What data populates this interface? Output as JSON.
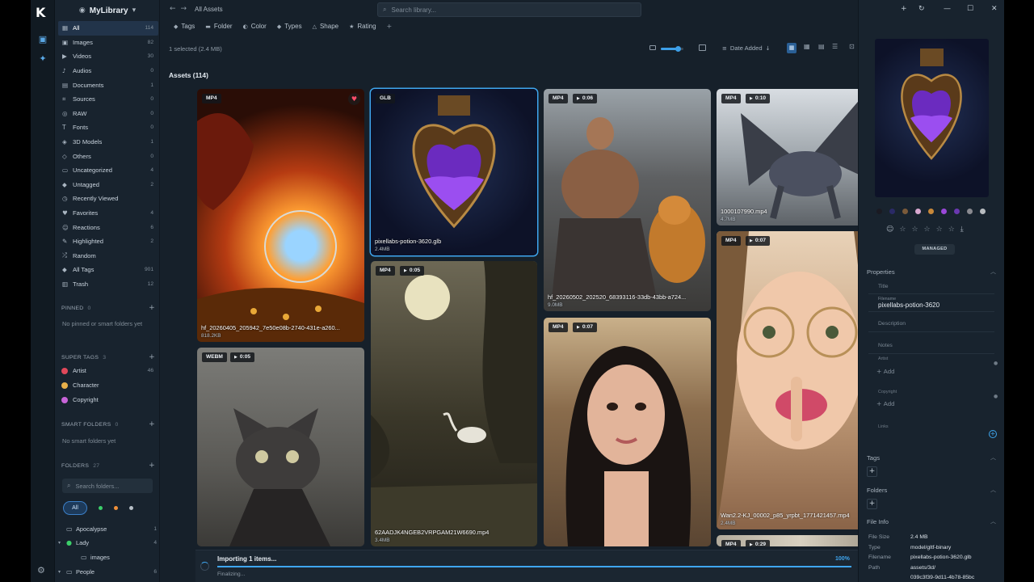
{
  "app": {
    "logo": "K",
    "library_name": "MyLibrary"
  },
  "sidebar": {
    "items": [
      {
        "icon": "grid-icon",
        "glyph": "▦",
        "label": "All",
        "count": "114",
        "active": true
      },
      {
        "icon": "image-icon",
        "glyph": "▣",
        "label": "Images",
        "count": "82"
      },
      {
        "icon": "video-icon",
        "glyph": "▶",
        "label": "Videos",
        "count": "30"
      },
      {
        "icon": "audio-icon",
        "glyph": "♪",
        "label": "Audios",
        "count": "0"
      },
      {
        "icon": "document-icon",
        "glyph": "▤",
        "label": "Documents",
        "count": "1"
      },
      {
        "icon": "source-icon",
        "glyph": "⌗",
        "label": "Sources",
        "count": "0"
      },
      {
        "icon": "raw-icon",
        "glyph": "◎",
        "label": "RAW",
        "count": "0"
      },
      {
        "icon": "font-icon",
        "glyph": "T",
        "label": "Fonts",
        "count": "0"
      },
      {
        "icon": "cube-icon",
        "glyph": "◈",
        "label": "3D Models",
        "count": "1"
      },
      {
        "icon": "other-icon",
        "glyph": "◇",
        "label": "Others",
        "count": "0"
      },
      {
        "icon": "uncategorized-icon",
        "glyph": "▭",
        "label": "Uncategorized",
        "count": "4"
      },
      {
        "icon": "tag-icon",
        "glyph": "◆",
        "label": "Untagged",
        "count": "2"
      },
      {
        "icon": "clock-icon",
        "glyph": "◷",
        "label": "Recently Viewed",
        "count": ""
      },
      {
        "icon": "heart-icon",
        "glyph": "♥",
        "label": "Favorites",
        "count": "4"
      },
      {
        "icon": "reaction-icon",
        "glyph": "☺",
        "label": "Reactions",
        "count": "6"
      },
      {
        "icon": "highlight-icon",
        "glyph": "✎",
        "label": "Highlighted",
        "count": "2"
      },
      {
        "icon": "shuffle-icon",
        "glyph": "⤮",
        "label": "Random",
        "count": ""
      },
      {
        "icon": "tags-icon",
        "glyph": "◆",
        "label": "All Tags",
        "count": "901"
      },
      {
        "icon": "trash-icon",
        "glyph": "▥",
        "label": "Trash",
        "count": "12"
      }
    ],
    "pinned": {
      "title": "PINNED",
      "count": "0",
      "empty": "No pinned or smart folders yet"
    },
    "super_tags": {
      "title": "SUPER TAGS",
      "count": "3",
      "items": [
        {
          "label": "Artist",
          "count": "46",
          "color": "#e0485a"
        },
        {
          "label": "Character",
          "count": "",
          "color": "#e8b04a"
        },
        {
          "label": "Copyright",
          "count": "",
          "color": "#c764d8"
        }
      ]
    },
    "smart_folders": {
      "title": "SMART FOLDERS",
      "count": "0",
      "empty": "No smart folders yet"
    },
    "folders": {
      "title": "FOLDERS",
      "count": "27",
      "search_placeholder": "Search folders...",
      "filter_all": "All",
      "filter_colors": [
        "#3ccf6a",
        "#f0903a",
        "#b8c0c8"
      ],
      "items": [
        {
          "label": "Apocalypse",
          "count": "1",
          "level": 0,
          "twisty": ""
        },
        {
          "label": "Lady",
          "count": "4",
          "level": 0,
          "twisty": "▾",
          "color": "#3ccf6a"
        },
        {
          "label": "images",
          "count": "",
          "level": 1,
          "twisty": ""
        },
        {
          "label": "People",
          "count": "6",
          "level": 0,
          "twisty": "▾"
        }
      ]
    }
  },
  "toolbar": {
    "breadcrumb": "All Assets",
    "search_placeholder": "Search library...",
    "filters": [
      {
        "icon": "tag-icon",
        "glyph": "◆",
        "label": "Tags"
      },
      {
        "icon": "folder-icon",
        "glyph": "▬",
        "label": "Folder"
      },
      {
        "icon": "palette-icon",
        "glyph": "◐",
        "label": "Color"
      },
      {
        "icon": "types-icon",
        "glyph": "◆",
        "label": "Types"
      },
      {
        "icon": "shape-icon",
        "glyph": "△",
        "label": "Shape"
      },
      {
        "icon": "star-icon",
        "glyph": "★",
        "label": "Rating"
      }
    ],
    "selection_text": "1 selected (2.4 MB)",
    "sort_label": "Date Added",
    "thumb_size": 0.78
  },
  "assets": {
    "heading": "Assets (114)",
    "cards": [
      {
        "type": "MP4",
        "duration": "",
        "filename": "hf_20260405_205942_7e50e08b-2740-431e-a260...",
        "size": "818.2KB",
        "favorite": true
      },
      {
        "type": "GLB",
        "duration": "",
        "filename": "pixellabs-potion-3620.glb",
        "size": "2.4MB",
        "selected": true
      },
      {
        "type": "MP4",
        "duration": "0:06",
        "filename": "hf_20260502_202520_68393116-33db-43bb-a724...",
        "size": "9.0MB"
      },
      {
        "type": "MP4",
        "duration": "0:10",
        "filename": "1000107990.mp4",
        "size": "4.7MB"
      },
      {
        "type": "WEBM",
        "duration": "0:05",
        "filename": "",
        "size": ""
      },
      {
        "type": "MP4",
        "duration": "0:05",
        "filename": "62AADJK4NGEB2VRPGAM21W6690.mp4",
        "size": "3.4MB"
      },
      {
        "type": "MP4",
        "duration": "0:07",
        "filename": "",
        "size": ""
      },
      {
        "type": "MP4",
        "duration": "0:07",
        "filename": "Wan2.2-KJ_00002_p85_yrpbt_1771421457.mp4",
        "size": "2.4MB"
      },
      {
        "type": "MP4",
        "duration": "0:29",
        "filename": "",
        "size": ""
      }
    ]
  },
  "import": {
    "title": "Importing 1 items...",
    "status": "Finalizing...",
    "percent": "100%",
    "progress": 1.0
  },
  "inspector": {
    "swatches": [
      "#1a1a22",
      "#2a2a66",
      "#7a5a3a",
      "#d8a8d0",
      "#c8883a",
      "#9a48d8",
      "#6a38b0",
      "#8a8a90",
      "#b8bcc0"
    ],
    "managed_label": "MANAGED",
    "properties_heading": "Properties",
    "title_placeholder": "Title",
    "filename_label": "Filename",
    "filename_value": "pixellabs-potion-3620",
    "description_placeholder": "Description",
    "notes_placeholder": "Notes",
    "artist_label": "Artist",
    "copyright_label": "Copyright",
    "add_label": "Add",
    "links_label": "Links",
    "tags_heading": "Tags",
    "folders_heading": "Folders",
    "fileinfo_heading": "File Info",
    "fileinfo": [
      {
        "k": "File Size",
        "v": "2.4 MB"
      },
      {
        "k": "Type",
        "v": "model/gltf-binary"
      },
      {
        "k": "Filename",
        "v": "pixellabs-potion-3620.glb"
      },
      {
        "k": "Path",
        "v": "assets/3d/"
      },
      {
        "k": "",
        "v": "039c3f39-9d11-4b78-85bc"
      }
    ]
  }
}
